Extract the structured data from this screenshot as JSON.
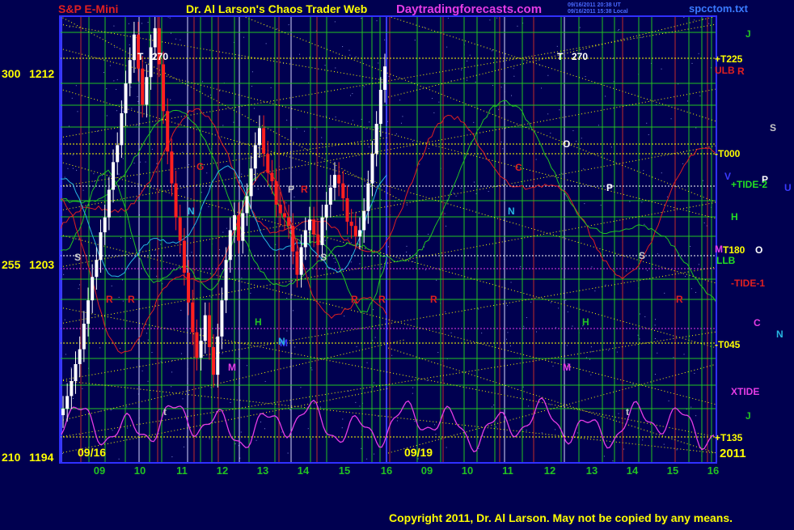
{
  "header": {
    "symbol": "S&P E-Mini",
    "title": "Dr. Al Larson's Chaos Trader Web",
    "site": "Daytradingforecasts.com",
    "file": "spcctom.txt",
    "timestamp_1": "09/16/2011 20:38 UT",
    "timestamp_2": "09/16/2011 15:38 Local"
  },
  "footer": {
    "copyright": "Copyright 2011, Dr. Al Larson. May not be copied by any means."
  },
  "colors": {
    "background": "#000050",
    "plot_border": "#3030ff",
    "grid_green": "#22c322",
    "grid_red": "#c02a2a",
    "yellow": "#ffff00",
    "magenta": "#e63ce6",
    "cyan": "#27b6e0",
    "white": "#ffffff"
  },
  "chart_data": {
    "type": "bar",
    "title": "S&P E-Mini",
    "y_axis": {
      "ticks": [
        {
          "label_left": "300",
          "label_right": "1212",
          "value": 1212
        },
        {
          "label_left": "255",
          "label_right": "1203",
          "value": 1203
        },
        {
          "label_left": "210",
          "label_right": "1194",
          "value": 1194
        }
      ],
      "ylim": [
        1194,
        1215
      ]
    },
    "x_axis": {
      "dates": [
        "09/16",
        "09/19"
      ],
      "year": "2011",
      "hour_ticks": [
        "09",
        "10",
        "11",
        "12",
        "13",
        "14",
        "15",
        "16",
        "09",
        "10",
        "11",
        "12",
        "13",
        "14",
        "15",
        "16"
      ]
    },
    "price_bars_session_1": [
      1196.2,
      1196.8,
      1197.5,
      1198.3,
      1199.0,
      1200.2,
      1201.3,
      1202.4,
      1203.2,
      1204.5,
      1205.2,
      1206.5,
      1207.8,
      1208.6,
      1210.1,
      1211.5,
      1212.6,
      1213.8,
      1212.2,
      1210.5,
      1211.8,
      1213.2,
      1214.1,
      1212.4,
      1210.2,
      1208.3,
      1206.8,
      1205.2,
      1204.1,
      1202.6,
      1201.2,
      1199.8,
      1198.6,
      1199.4,
      1200.6,
      1199.1,
      1197.8,
      1199.6,
      1201.3,
      1203.2,
      1204.6,
      1205.3,
      1204.1,
      1205.4,
      1206.2,
      1207.5,
      1208.6,
      1209.4,
      1208.2,
      1207.3,
      1206.9,
      1205.8,
      1205.4,
      1205.2,
      1204.8,
      1203.6,
      1202.5,
      1203.8,
      1204.6,
      1205.1,
      1204.4,
      1203.9,
      1205.2,
      1205.8,
      1206.6,
      1207.2,
      1206.8,
      1206.1,
      1205.0,
      1204.8,
      1204.3,
      1204.6,
      1205.5,
      1206.8,
      1208.2,
      1209.6,
      1211.2,
      1212.3
    ],
    "annotations": {
      "left_labels": [
        "T",
        "270",
        "G",
        "N",
        "S",
        "P",
        "S",
        "R",
        "R",
        "H",
        "M",
        "M",
        "t",
        "R",
        "R",
        "R",
        "N"
      ],
      "right_labels": [
        "T",
        "270",
        "O",
        "C",
        "N",
        "P",
        "S",
        "M",
        "H",
        "R",
        "R",
        "t"
      ],
      "side_labels": [
        {
          "text": "J",
          "color": "#22c322"
        },
        {
          "text": "+T225",
          "color": "#ffff00"
        },
        {
          "text": "ULB",
          "color": "#e02020"
        },
        {
          "text": "R",
          "color": "#e02020"
        },
        {
          "text": "S",
          "color": "#c8c8c8"
        },
        {
          "text": "-T000",
          "color": "#ffff00"
        },
        {
          "text": "V",
          "color": "#3a3aff"
        },
        {
          "text": "P",
          "color": "#ffffff"
        },
        {
          "text": "+TIDE-2",
          "color": "#22e022"
        },
        {
          "text": "U",
          "color": "#3a3aff"
        },
        {
          "text": "H",
          "color": "#22e022"
        },
        {
          "text": "M",
          "color": "#e63ce6"
        },
        {
          "text": "T180",
          "color": "#ffff00"
        },
        {
          "text": "O",
          "color": "#ffffff"
        },
        {
          "text": "LLB",
          "color": "#22e022"
        },
        {
          "text": "-TIDE-1",
          "color": "#e02020"
        },
        {
          "text": "C",
          "color": "#e63ce6"
        },
        {
          "text": "N",
          "color": "#27b6e0"
        },
        {
          "text": "-T045",
          "color": "#ffff00"
        },
        {
          "text": "XTIDE",
          "color": "#e63ce6"
        },
        {
          "text": "J",
          "color": "#22c322"
        },
        {
          "text": "+T135",
          "color": "#ffff00"
        }
      ]
    }
  }
}
